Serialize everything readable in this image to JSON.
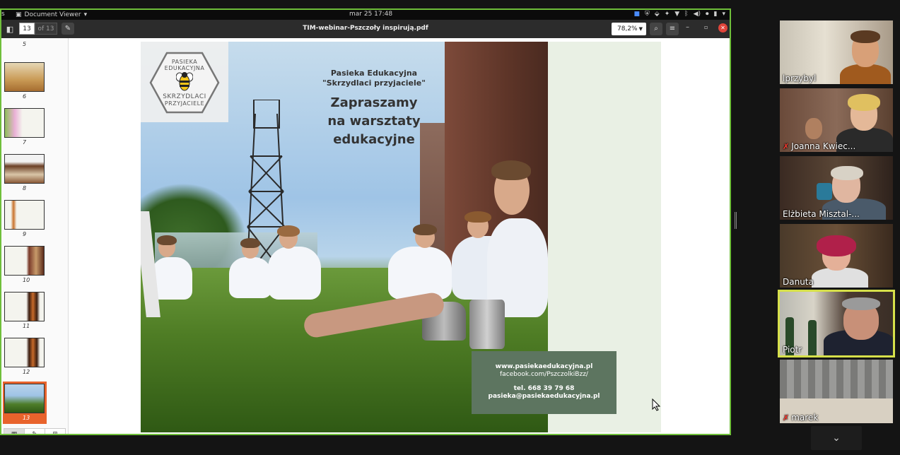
{
  "system_bar": {
    "left_letter": "s",
    "app_name": "Document Viewer",
    "clock": "mar 25  17:48"
  },
  "viewer": {
    "current_page": "13",
    "page_total": "of 13",
    "doc_title": "TIM-webinar-Pszczoły inspirują.pdf",
    "zoom": "78,2%"
  },
  "thumbnails": [
    {
      "num": "5"
    },
    {
      "num": "6"
    },
    {
      "num": "7"
    },
    {
      "num": "8"
    },
    {
      "num": "9"
    },
    {
      "num": "10"
    },
    {
      "num": "11"
    },
    {
      "num": "12"
    },
    {
      "num": "13"
    }
  ],
  "slide": {
    "logo_top_1": "PASIEKA",
    "logo_top_2": "EDUKACYJNA",
    "logo_bottom_1": "SKRZYDLACI",
    "logo_bottom_2": "PRZYJACIELE",
    "org_name": "Pasieka Edukacyjna",
    "org_sub": "\"Skrzydlaci przyjaciele\"",
    "headline_1": "Zapraszamy",
    "headline_2": "na warsztaty",
    "headline_3": "edukacyjne",
    "website": "www.pasiekaedukacyjna.pl",
    "facebook": "facebook.com/PszczolkiBzz/",
    "phone": "tel. 668 39 79 68",
    "email": "pasieka@pasiekaedukacyjna.pl"
  },
  "participants": [
    {
      "name": "lprzybyl",
      "muted": false
    },
    {
      "name": "Joanna Kwiec...",
      "muted": true
    },
    {
      "name": "Elżbieta Misztal-...",
      "muted": false
    },
    {
      "name": "Danuta",
      "muted": false
    },
    {
      "name": "Piotr",
      "muted": false
    },
    {
      "name": "marek",
      "muted": true
    }
  ],
  "icons": {
    "sidebar_toggle": "sidebar-icon",
    "pen": "pen-icon",
    "search": "search-icon",
    "menu": "hamburger-icon",
    "close": "close-icon",
    "scroll": "chevron-down-icon"
  },
  "colors": {
    "active_thumb": "#e8632c",
    "share_border": "#6fbf3a",
    "speaker_border": "#d6e04a",
    "contact_box": "#5d7560"
  }
}
